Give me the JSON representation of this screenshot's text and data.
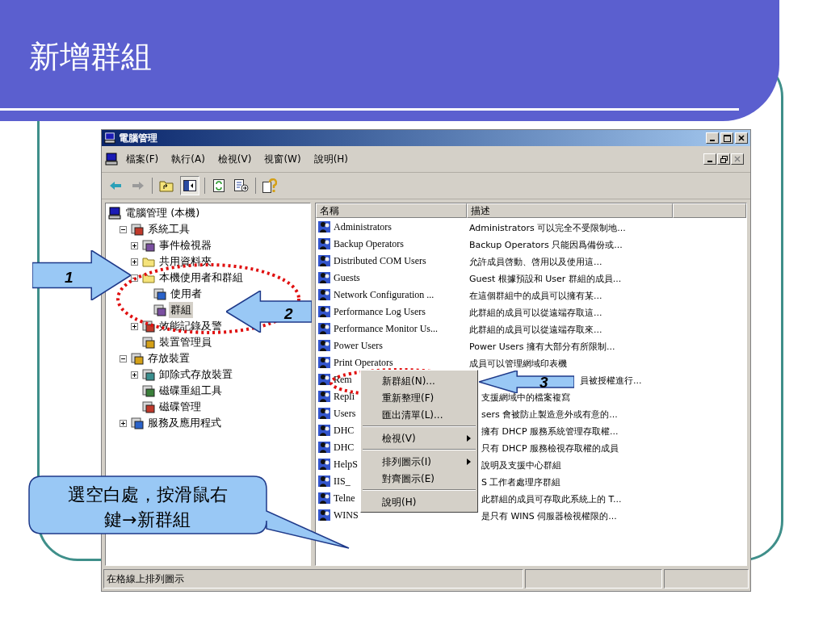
{
  "slide": {
    "title": "新增群組"
  },
  "window": {
    "title": "電腦管理",
    "menu": [
      "檔案(F)",
      "執行(A)",
      "檢視(V)",
      "視窗(W)",
      "說明(H)"
    ]
  },
  "tree": [
    {
      "label": "電腦管理 (本機)",
      "selected": false,
      "children": [
        {
          "label": "系統工具",
          "expanded": true,
          "selected": false,
          "children": [
            {
              "label": "事件檢視器",
              "expanded": false,
              "selected": false
            },
            {
              "label": "共用資料夾",
              "expanded": false,
              "selected": false
            },
            {
              "label": "本機使用者和群組",
              "expanded": true,
              "selected": false,
              "children": [
                {
                  "label": "使用者",
                  "selected": false
                },
                {
                  "label": "群組",
                  "selected": true
                }
              ]
            },
            {
              "label": "效能記錄及警",
              "expanded": false,
              "selected": false
            },
            {
              "label": "裝置管理員",
              "selected": false
            }
          ]
        },
        {
          "label": "存放裝置",
          "expanded": true,
          "selected": false,
          "children": [
            {
              "label": "卸除式存放裝置",
              "expanded": false,
              "selected": false
            },
            {
              "label": "磁碟重組工具",
              "selected": false
            },
            {
              "label": "磁碟管理",
              "selected": false
            }
          ]
        },
        {
          "label": "服務及應用程式",
          "expanded": false,
          "selected": false
        }
      ]
    }
  ],
  "list": {
    "columns": [
      "名稱",
      "描述"
    ],
    "rows": [
      {
        "name": "Administrators",
        "description": "Administrators 可以完全不受限制地...",
        "kind": "full"
      },
      {
        "name": "Backup Operators",
        "description": "Backup Operators 只能因爲備份或...",
        "kind": "full"
      },
      {
        "name": "Distributed COM Users",
        "description": "允許成員啓動、啓用以及使用這...",
        "kind": "full"
      },
      {
        "name": "Guests",
        "description": "Guest 根據預設和 User 群組的成員...",
        "kind": "full"
      },
      {
        "name": "Network Configuration ...",
        "description": "在這個群組中的成員可以擁有某...",
        "kind": "full"
      },
      {
        "name": "Performance Log Users",
        "description": "此群組的成員可以從遠端存取這...",
        "kind": "full"
      },
      {
        "name": "Performance Monitor Us...",
        "description": "此群組的成員可以從遠端存取來...",
        "kind": "full"
      },
      {
        "name": "Power Users",
        "description": "Power Users 擁有大部分有所限制...",
        "kind": "full"
      },
      {
        "name": "Print Operators",
        "description": "成員可以管理網域印表機",
        "kind": "full"
      },
      {
        "name": "Rem",
        "description": "員被授權進行...",
        "kind": "clipped"
      },
      {
        "name": "Repli",
        "description": "支援網域中的檔案複寫",
        "kind": "clipped"
      },
      {
        "name": "Users",
        "description": "sers 會被防止製造意外或有意的...",
        "kind": "clipped"
      },
      {
        "name": "DHC",
        "description": "擁有 DHCP 服務系統管理存取權...",
        "kind": "clipped"
      },
      {
        "name": "DHC",
        "description": "只有 DHCP 服務檢視存取權的成員",
        "kind": "clipped"
      },
      {
        "name": "HelpS",
        "description": "說明及支援中心群組",
        "kind": "clipped"
      },
      {
        "name": "IIS_",
        "description": "S 工作者處理序群組",
        "kind": "clipped"
      },
      {
        "name": "Telne",
        "description": "此群組的成員可存取此系統上的 T...",
        "kind": "clipped"
      },
      {
        "name": "WINS",
        "description": "是只有 WINS 伺服器檢視權限的...",
        "kind": "clipped"
      }
    ]
  },
  "context_menu": [
    {
      "kind": "item",
      "label": "新群組(N)...",
      "submenu": false
    },
    {
      "kind": "item",
      "label": "重新整理(F)",
      "submenu": false
    },
    {
      "kind": "item",
      "label": "匯出清單(L)...",
      "submenu": false
    },
    {
      "kind": "separator"
    },
    {
      "kind": "item",
      "label": "檢視(V)",
      "submenu": true
    },
    {
      "kind": "separator"
    },
    {
      "kind": "item",
      "label": "排列圖示(I)",
      "submenu": true
    },
    {
      "kind": "item",
      "label": "對齊圖示(E)",
      "submenu": false
    },
    {
      "kind": "separator"
    },
    {
      "kind": "item",
      "label": "說明(H)",
      "submenu": false
    }
  ],
  "status_bar": {
    "text": "在格線上排列圖示"
  },
  "steps": [
    {
      "number": "1",
      "kind": "right_arrow"
    },
    {
      "number": "2",
      "kind": "left_arrow"
    },
    {
      "number": "3",
      "kind": "left_arrow"
    }
  ],
  "callout": {
    "text": "選空白處，按滑鼠右鍵→新群組"
  }
}
